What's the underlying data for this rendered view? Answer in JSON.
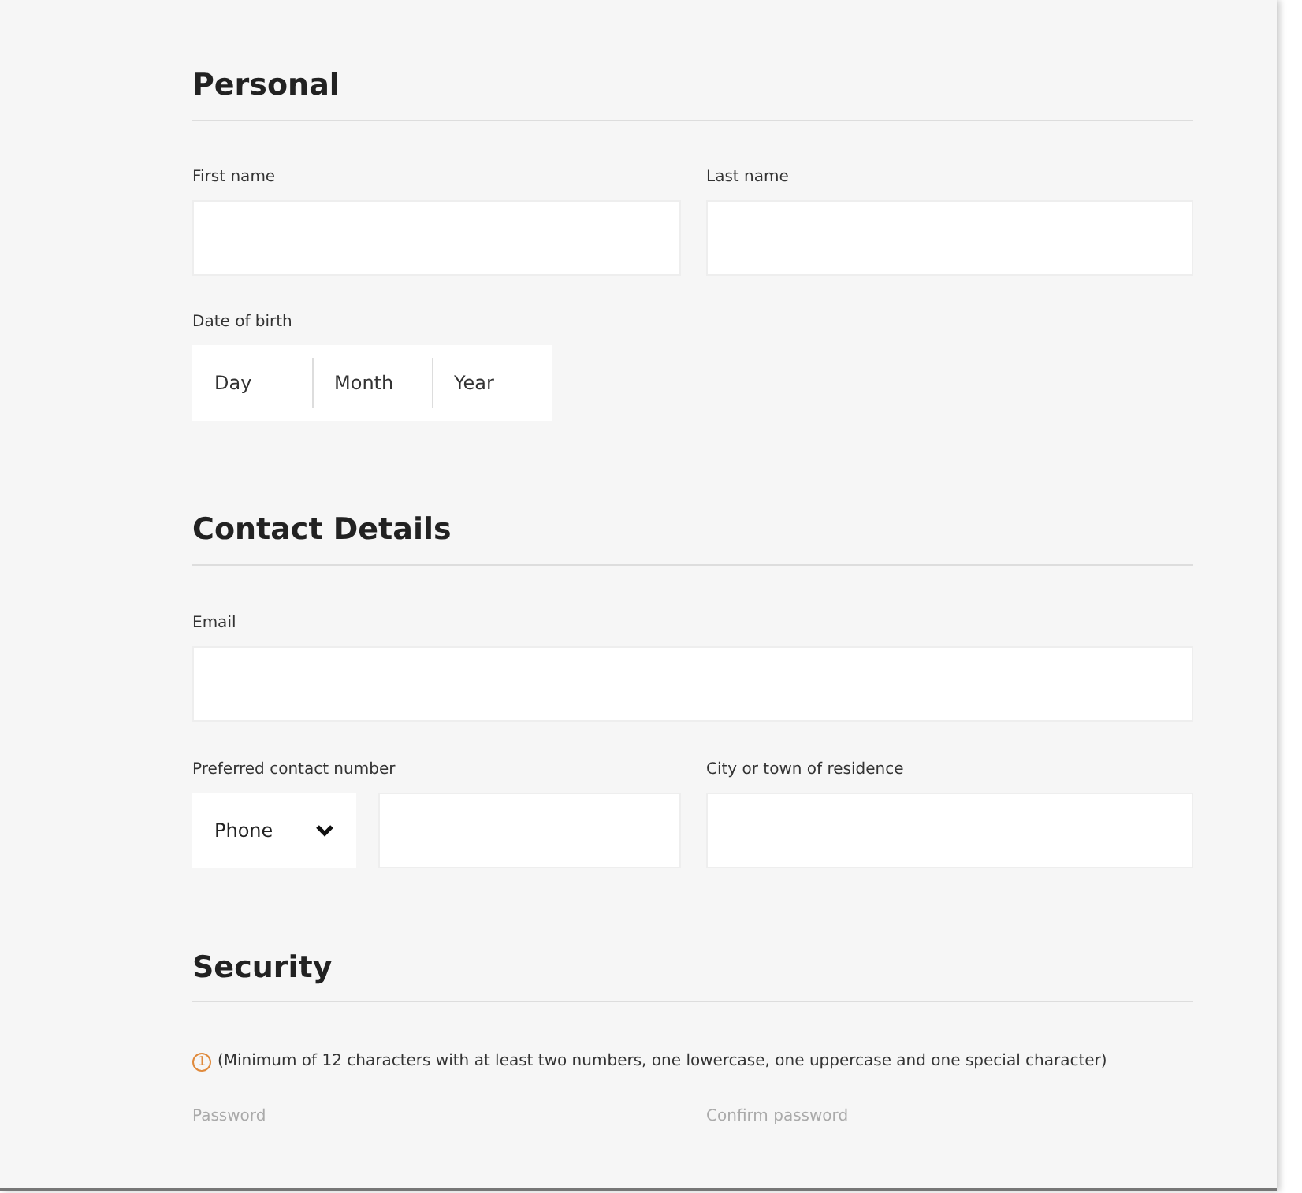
{
  "personal": {
    "title": "Personal",
    "first_name": {
      "label": "First name"
    },
    "last_name": {
      "label": "Last name"
    },
    "date_of_birth": {
      "label": "Date of birth",
      "parts": [
        {
          "placeholder": "Day"
        },
        {
          "placeholder": "Month"
        },
        {
          "placeholder": "Year"
        }
      ]
    }
  },
  "contact": {
    "title": "Contact Details",
    "email": {
      "label": "Email"
    },
    "contact_number": {
      "label": "Preferred contact number",
      "type": "Phone"
    },
    "city": {
      "label": "City or town of residence"
    }
  },
  "security": {
    "title": "Security",
    "hint_icon": "1",
    "hint": "(Minimum of 12 characters with at least two numbers, one lowercase, one uppercase and one special character)",
    "password": {
      "label": "Password"
    },
    "confirm_password": {
      "label": "Confirm password"
    }
  }
}
